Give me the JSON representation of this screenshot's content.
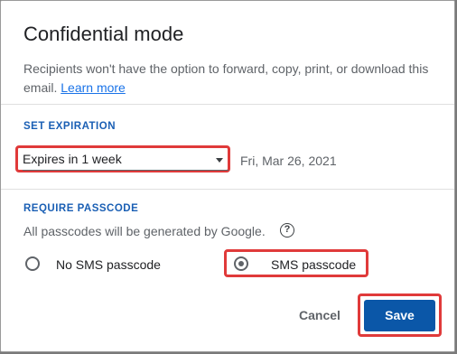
{
  "dialog": {
    "title": "Confidential mode",
    "description": "Recipients won't have the option to forward, copy, print, or download this email.",
    "learn_more": "Learn more"
  },
  "expiration": {
    "section_title": "SET EXPIRATION",
    "selected": "Expires in 1 week",
    "date": "Fri, Mar 26, 2021"
  },
  "passcode": {
    "section_title": "REQUIRE PASSCODE",
    "note": "All passcodes will be generated by Google.",
    "options": [
      {
        "label": "No SMS passcode",
        "selected": false
      },
      {
        "label": "SMS passcode",
        "selected": true
      }
    ]
  },
  "actions": {
    "cancel": "Cancel",
    "save": "Save"
  },
  "colors": {
    "accent": "#0b57a8",
    "link": "#1a73e8",
    "highlight": "#e03a3a"
  },
  "icons": {
    "help": "help-circle-icon",
    "dropdown": "chevron-down-icon"
  }
}
